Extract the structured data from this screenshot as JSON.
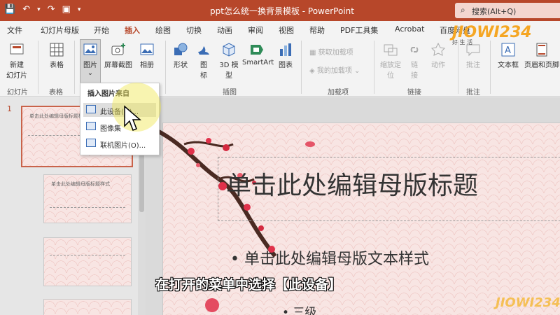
{
  "window": {
    "title": "ppt怎么统一换背景模板 - PowerPoint",
    "search_placeholder": "搜索(Alt+Q)"
  },
  "ribbon_tabs": [
    "文件",
    "幻灯片母版",
    "开始",
    "插入",
    "绘图",
    "切换",
    "动画",
    "审阅",
    "视图",
    "帮助",
    "PDF工具集",
    "Acrobat",
    "百度网盘"
  ],
  "active_tab": "插入",
  "ribbon": {
    "new_slide": "新建\n幻灯片",
    "table": "表格",
    "picture": "图片",
    "screenshot": "屏幕截图",
    "album": "相册",
    "shapes": "形状",
    "icons": "图\n标",
    "model3d": "3D 模\n型",
    "smartart": "SmartArt",
    "chart": "图表",
    "get_addins": "获取加载项",
    "my_addins": "我的加载项",
    "zoom": "缩放定\n位",
    "link": "链\n接",
    "action": "动作",
    "comment": "批注",
    "textbox": "文本框",
    "header_footer": "页眉和页脚",
    "groups": {
      "slides": "幻灯片",
      "tables": "表格",
      "illustrations": "插图",
      "addins": "加载项",
      "links": "链接",
      "comments": "批注"
    }
  },
  "menu": {
    "header": "插入图片来自",
    "items": [
      "此设备(D)...",
      "图像集",
      "联机图片(O)..."
    ]
  },
  "slide_panel": {
    "number": "1",
    "thumb_title": "单击此处编辑母版标题样式"
  },
  "slide": {
    "title": "单击此处编辑母版标题",
    "bullet1": "• 单击此处编辑母版文本样式",
    "bullet3": "• 三级"
  },
  "subtitle": "在打开的菜单中选择【此设备】",
  "watermark": {
    "logo": "JIOWI234",
    "tagline": "好 生 活",
    "logo_bottom": "JIOWI234"
  },
  "colors": {
    "accent": "#b7472a",
    "ribbon_bg": "#f3f3f3",
    "blossom": "#e0314a"
  }
}
